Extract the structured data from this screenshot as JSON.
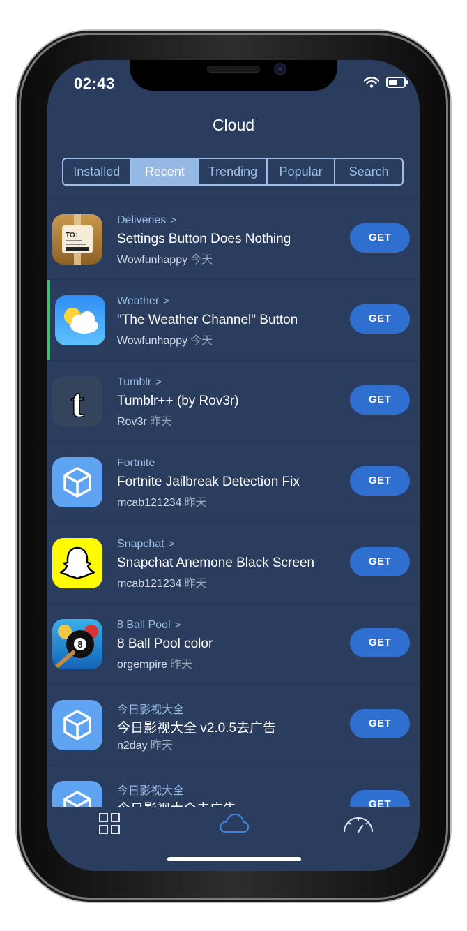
{
  "status": {
    "time": "02:43",
    "signal_dots": ".....",
    "wifi_icon": "wifi-icon",
    "battery_icon": "battery-icon"
  },
  "header": {
    "title": "Cloud"
  },
  "tabs": [
    {
      "label": "Installed",
      "active": false
    },
    {
      "label": "Recent",
      "active": true
    },
    {
      "label": "Trending",
      "active": false
    },
    {
      "label": "Popular",
      "active": false
    },
    {
      "label": "Search",
      "active": false
    }
  ],
  "items": [
    {
      "category": "Deliveries",
      "name": "Settings Button Does Nothing",
      "author": "Wowfunhappy",
      "when": "今天",
      "action": "GET",
      "icon": "deliveries-app-icon"
    },
    {
      "category": "Weather",
      "name": "\"The Weather Channel\" Button",
      "author": "Wowfunhappy",
      "when": "今天",
      "action": "GET",
      "icon": "weather-app-icon"
    },
    {
      "category": "Tumblr",
      "name": "Tumblr++ (by Rov3r)",
      "author": "Rov3r",
      "when": "昨天",
      "action": "GET",
      "icon": "tumblr-app-icon"
    },
    {
      "category": "Fortnite",
      "name": "Fortnite Jailbreak Detection Fix",
      "author": "mcab121234",
      "when": "昨天",
      "action": "GET",
      "icon": "package-cube-icon"
    },
    {
      "category": "Snapchat",
      "name": "Snapchat Anemone Black Screen",
      "author": "mcab121234",
      "when": "昨天",
      "action": "GET",
      "icon": "snapchat-app-icon"
    },
    {
      "category": "8 Ball Pool",
      "name": "8 Ball Pool color",
      "author": "orgempire",
      "when": "昨天",
      "action": "GET",
      "icon": "eight-ball-pool-app-icon"
    },
    {
      "category": "今日影视大全",
      "name": "今日影视大全 v2.0.5去广告",
      "author": "n2day",
      "when": "昨天",
      "action": "GET",
      "icon": "package-cube-icon"
    },
    {
      "category": "今日影视大全",
      "name": "今日影视大全去广告",
      "author": "",
      "when": "",
      "action": "GET",
      "icon": "package-cube-icon"
    }
  ],
  "tabbar": [
    {
      "icon": "grid-icon"
    },
    {
      "icon": "cloud-icon"
    },
    {
      "icon": "speedometer-icon"
    }
  ],
  "colors": {
    "background": "#2b3d5f",
    "accent": "#2f6fd0",
    "segment": "#9bbfe8",
    "selected_marker": "#3ec16b"
  }
}
